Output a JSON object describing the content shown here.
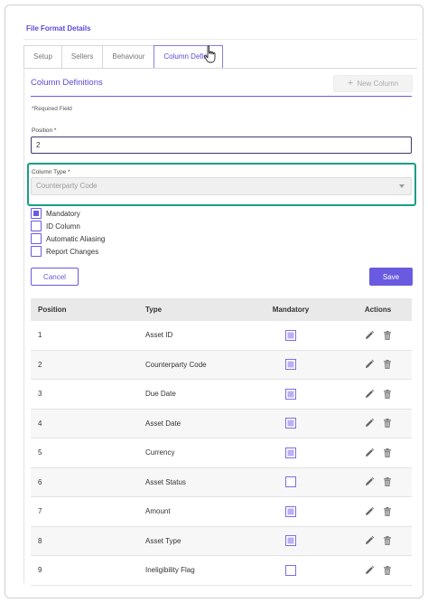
{
  "header": {
    "title": "File Format Details"
  },
  "tabs": [
    {
      "label": "Setup"
    },
    {
      "label": "Sellers"
    },
    {
      "label": "Behaviour"
    },
    {
      "label": "Column Definiti"
    }
  ],
  "section": {
    "title": "Column Definitions",
    "new_column_label": "New Column"
  },
  "form": {
    "required_note": "*Required Field",
    "position_label": "Position *",
    "position_value": "2",
    "column_type_label": "Column Type *",
    "column_type_value": "Counterparty Code",
    "checkboxes": [
      {
        "label": "Mandatory",
        "checked": true
      },
      {
        "label": "ID Column",
        "checked": false
      },
      {
        "label": "Automatic Aliasing",
        "checked": false
      },
      {
        "label": "Report Changes",
        "checked": false
      }
    ],
    "cancel_label": "Cancel",
    "save_label": "Save"
  },
  "table": {
    "headers": {
      "position": "Position",
      "type": "Type",
      "mandatory": "Mandatory",
      "actions": "Actions"
    },
    "rows": [
      {
        "position": "1",
        "type": "Asset ID",
        "mandatory": true
      },
      {
        "position": "2",
        "type": "Counterparty Code",
        "mandatory": true
      },
      {
        "position": "3",
        "type": "Due Date",
        "mandatory": true
      },
      {
        "position": "4",
        "type": "Asset Date",
        "mandatory": true
      },
      {
        "position": "5",
        "type": "Currency",
        "mandatory": true
      },
      {
        "position": "6",
        "type": "Asset Status",
        "mandatory": false
      },
      {
        "position": "7",
        "type": "Amount",
        "mandatory": true
      },
      {
        "position": "8",
        "type": "Asset Type",
        "mandatory": true
      },
      {
        "position": "9",
        "type": "Ineligibility Flag",
        "mandatory": false
      }
    ]
  },
  "colors": {
    "accent": "#6a5ae0",
    "highlight": "#1a9e86",
    "header_bg": "#e9e9e9"
  },
  "icons": {
    "new_column": "plus-icon",
    "edit": "pencil-icon",
    "delete": "trash-icon",
    "select_caret": "caret-down-icon",
    "pointer": "hand-cursor-icon"
  }
}
